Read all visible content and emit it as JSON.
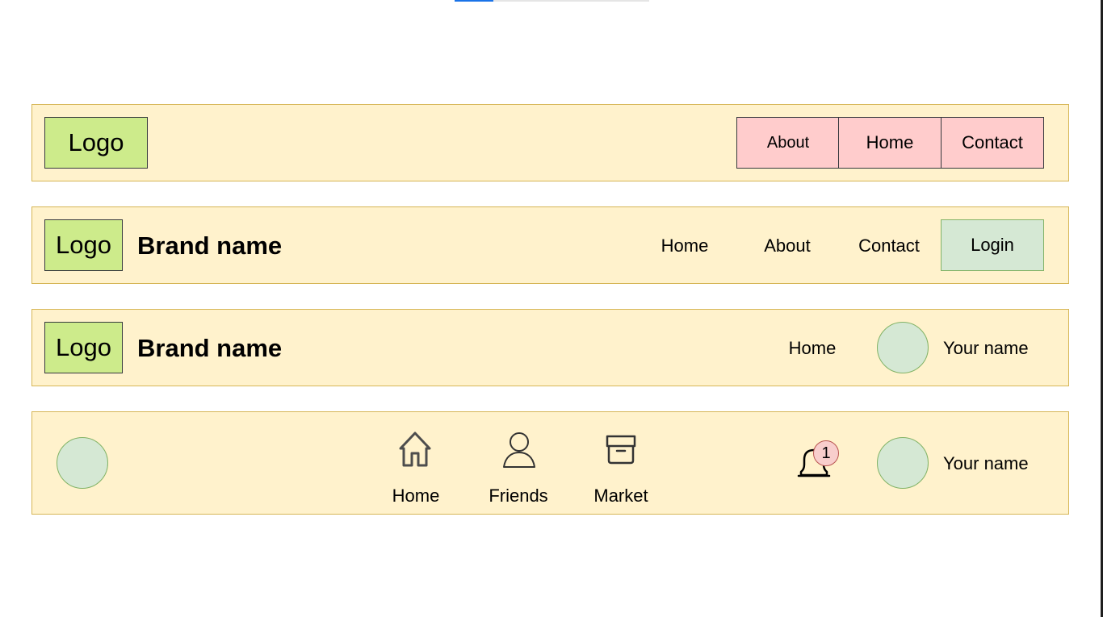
{
  "navbar1": {
    "logo": "Logo",
    "links": [
      "About",
      "Home",
      "Contact"
    ]
  },
  "navbar2": {
    "logo": "Logo",
    "brand": "Brand name",
    "links": [
      "Home",
      "About",
      "Contact"
    ],
    "login": "Login"
  },
  "navbar3": {
    "logo": "Logo",
    "brand": "Brand name",
    "link": "Home",
    "user_name": "Your name"
  },
  "navbar4": {
    "nav_items": [
      {
        "label": "Home",
        "icon": "home-icon"
      },
      {
        "label": "Friends",
        "icon": "person-icon"
      },
      {
        "label": "Market",
        "icon": "store-icon"
      }
    ],
    "notification_icon": "bell-icon",
    "notification_count": "1",
    "user_name": "Your name"
  },
  "colors": {
    "navbar_fill": "#fff2cc",
    "navbar_border": "#d6b656",
    "logo_fill": "#cdeb8b",
    "link_fill": "#ffcccc",
    "login_fill": "#d5e8d4",
    "avatar_fill": "#d5e8d4",
    "badge_fill": "#f8cecc"
  }
}
